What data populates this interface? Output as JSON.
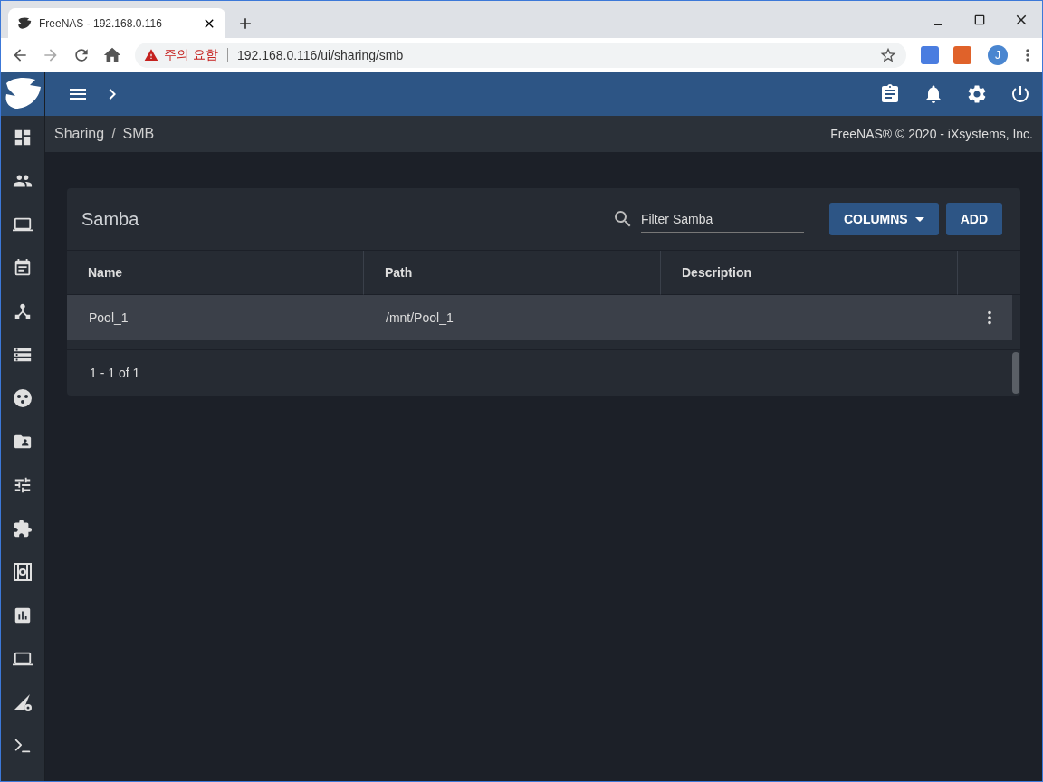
{
  "browser": {
    "tab_title": "FreeNAS - 192.168.0.116",
    "security_warning": "주의 요함",
    "url": "192.168.0.116/ui/sharing/smb",
    "profile_initial": "J"
  },
  "breadcrumb": {
    "items": [
      "Sharing",
      "SMB"
    ],
    "separator": "/"
  },
  "copyright": "FreeNAS® © 2020 - iXsystems, Inc.",
  "card": {
    "title": "Samba",
    "filter": {
      "placeholder": "Filter Samba"
    },
    "buttons": [
      {
        "label": "COLUMNS",
        "kind": "dropdown"
      },
      {
        "label": "ADD",
        "kind": "plain"
      }
    ],
    "table": {
      "columns": [
        "Name",
        "Path",
        "Description"
      ],
      "rows": [
        {
          "cells": [
            "Pool_1",
            "/mnt/Pool_1",
            ""
          ]
        }
      ]
    },
    "paginator": "1 - 1 of 1"
  }
}
